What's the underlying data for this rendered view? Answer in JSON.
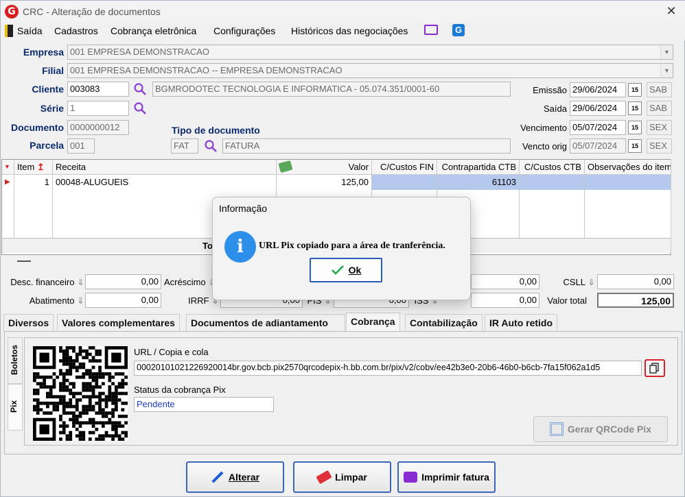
{
  "window": {
    "title": "CRC - Alteração de documentos",
    "logo": "G"
  },
  "menu": {
    "items": [
      "Saída",
      "Cadastros",
      "Cobrança eletrônica",
      "Configurações",
      "Históricos das negociações"
    ]
  },
  "form": {
    "empresa_label": "Empresa",
    "empresa_value": "001 EMPRESA DEMONSTRACAO",
    "filial_label": "Filial",
    "filial_value": "001 EMPRESA DEMONSTRACAO -- EMPRESA DEMONSTRACAO",
    "cliente_label": "Cliente",
    "cliente_code": "003083",
    "cliente_name": "BGMRODOTEC TECNOLOGIA  E INFORMATICA - 05.074.351/0001-60",
    "serie_label": "Série",
    "serie_value": "1",
    "documento_label": "Documento",
    "documento_value": "0000000012",
    "parcela_label": "Parcela",
    "parcela_value": "001",
    "tipo_label": "Tipo de documento",
    "tipo_code": "FAT",
    "tipo_name": "FATURA",
    "emissao_label": "Emissão",
    "emissao_value": "29/06/2024",
    "emissao_day": "SAB",
    "saida_label": "Saída",
    "saida_value": "29/06/2024",
    "saida_day": "SAB",
    "vencimento_label": "Vencimento",
    "vencimento_value": "05/07/2024",
    "vencimento_day": "SEX",
    "vencto_orig_label": "Vencto orig",
    "vencto_orig_value": "05/07/2024",
    "vencto_orig_day": "SEX",
    "cal_glyph": "15"
  },
  "grid": {
    "headers": [
      "Item",
      "Receita",
      "Valor",
      "C/Custos FIN",
      "Contrapartida CTB",
      "C/Custos CTB",
      "Observações do item"
    ],
    "row": {
      "item": "1",
      "receita": "00048-ALUGUEIS",
      "valor": "125,00",
      "contrapartida": "61103"
    },
    "total_label": "Tot"
  },
  "totals": {
    "desc_fin_label": "Desc. financeiro",
    "desc_fin_value": "0,00",
    "acrescimo_label": "Acréscimo",
    "abatimento_label": "Abatimento",
    "abatimento_value": "0,00",
    "irrf_label": "IRRF",
    "irrf_value": "0,00",
    "pis_label": "PIS",
    "pis_value": "0,00",
    "iss_label": "ISS",
    "iss_value": "0,00",
    "mid1_value": "0,00",
    "mid2_value": "0,00",
    "csll_label": "CSLL",
    "csll_value": "0,00",
    "valor_total_label": "Valor total",
    "valor_total_value": "125,00"
  },
  "tabs": [
    "Diversos",
    "Valores complementares",
    "Documentos de adiantamento",
    "Cobrança",
    "Contabilização",
    "IR Auto retido"
  ],
  "vtabs": [
    "Boletos",
    "Pix"
  ],
  "pix": {
    "url_label": "URL / Copia e cola",
    "url_value": "00020101021226920014br.gov.bcb.pix2570qrcodepix-h.bb.com.br/pix/v2/cobv/ee42b3e0-20b6-46b0-b6cb-7fa15f062a1d5",
    "status_label": "Status da cobrança Pix",
    "status_value": "Pendente",
    "gerar_label": "Gerar QRCode Pix"
  },
  "buttons": {
    "alterar": "Alterar",
    "limpar": "Limpar",
    "imprimir": "Imprimir fatura"
  },
  "dialog": {
    "title": "Informação",
    "message": "URL Pix copiado para a área de tranferência.",
    "ok": "Ok"
  },
  "colors": {
    "accent": "#2b5bb8",
    "label_blue": "#0a2a6e",
    "grid_selected": "#b5c9ee"
  }
}
